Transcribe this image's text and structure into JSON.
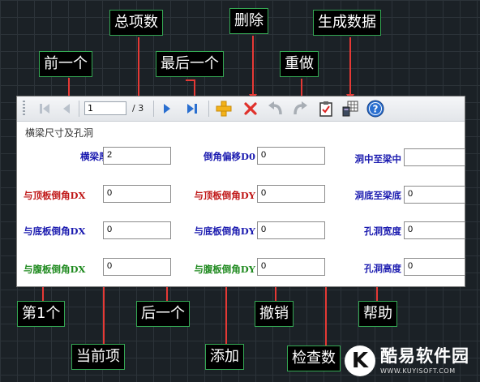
{
  "callouts": {
    "total_items": "总项数",
    "delete": "删除",
    "generate_data": "生成数据",
    "previous": "前一个",
    "last": "最后一个",
    "redo": "重做",
    "first": "第1个",
    "next": "后一个",
    "undo": "撤销",
    "help": "帮助",
    "current": "当前项",
    "add": "添加",
    "check": "检查数"
  },
  "toolbar": {
    "current_value": "1",
    "total_text": "/ 3"
  },
  "section_title": "横梁尺寸及孔洞",
  "fields": {
    "beam_thickness": {
      "label": "横梁厚度",
      "value": "2"
    },
    "chamfer_offset_d0": {
      "label": "倒角偏移D0",
      "value": "0"
    },
    "hole_center": {
      "label": "洞中至梁中",
      "value": ""
    },
    "top_chamfer_dx": {
      "label": "与顶板倒角DX",
      "value": "0"
    },
    "top_chamfer_dy": {
      "label": "与顶板倒角DY",
      "value": "0"
    },
    "hole_bottom": {
      "label": "洞底至梁底",
      "value": "0"
    },
    "bottom_chamfer_dx": {
      "label": "与底板倒角DX",
      "value": "0"
    },
    "bottom_chamfer_dy": {
      "label": "与底板倒角DY",
      "value": "0"
    },
    "hole_width": {
      "label": "孔洞宽度",
      "value": "0"
    },
    "web_chamfer_dx": {
      "label": "与腹板倒角DX",
      "value": "0"
    },
    "web_chamfer_dy": {
      "label": "与腹板倒角DY",
      "value": "0"
    },
    "hole_height": {
      "label": "孔洞高度",
      "value": "0"
    }
  },
  "colors": {
    "blue_label": "#1c1cb0",
    "red_label": "#c01818",
    "green_label": "#1f8a1f",
    "callout_border": "#34a853",
    "leader": "#e53935"
  },
  "icons": [
    "first-icon",
    "previous-icon",
    "next-icon",
    "last-icon",
    "add-icon",
    "delete-icon",
    "undo-icon",
    "redo-icon",
    "check-icon",
    "generate-data-icon",
    "help-icon"
  ],
  "watermark": {
    "name": "酷易软件园",
    "url": "WWW.KUYISOFT.COM",
    "badge": "K"
  }
}
